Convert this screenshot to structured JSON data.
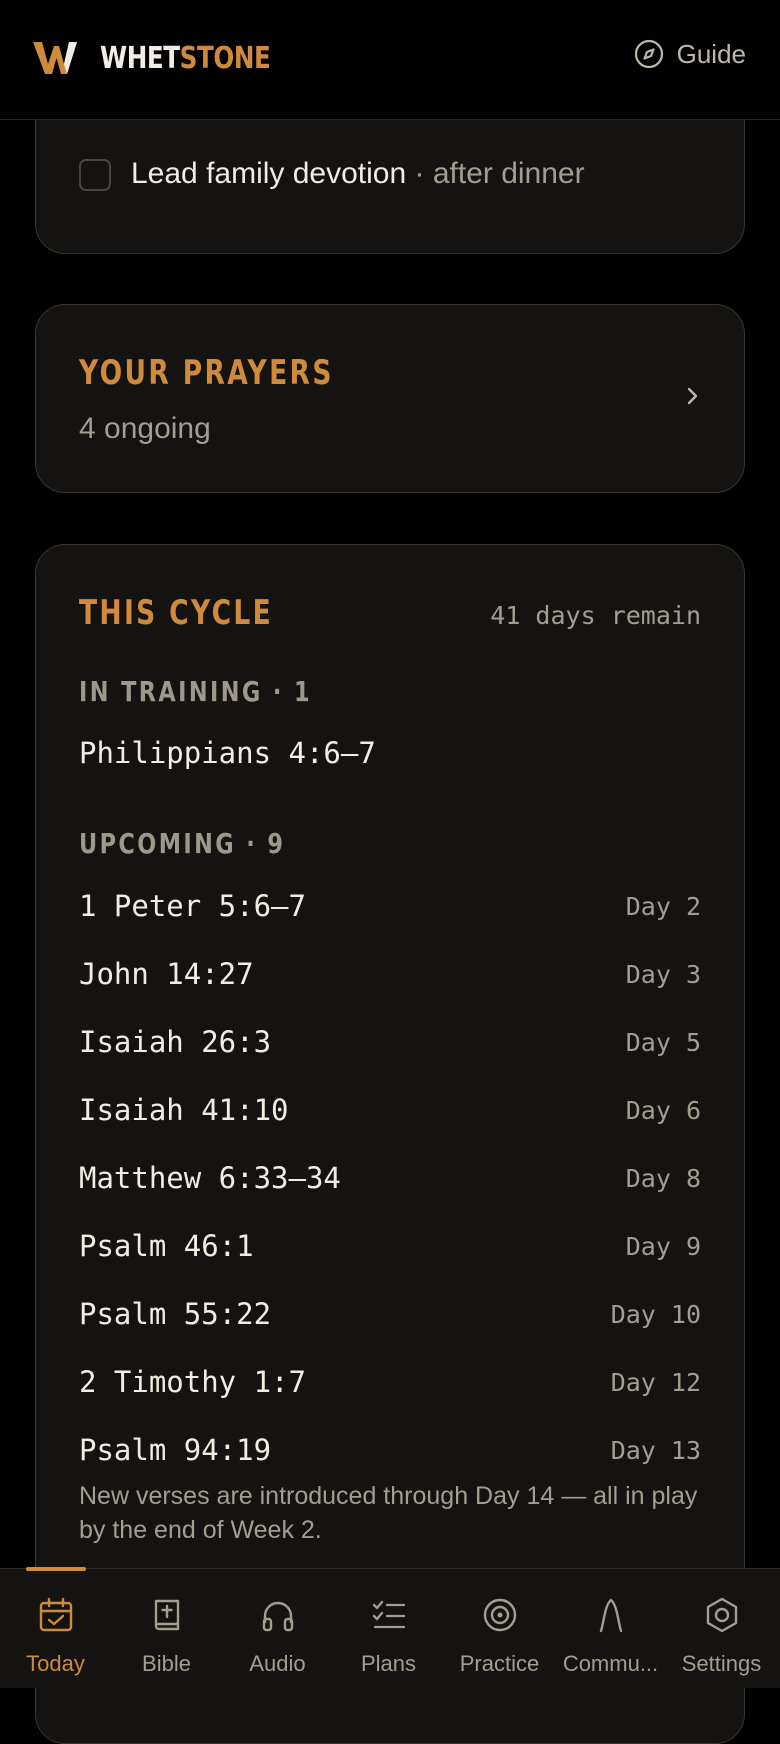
{
  "header": {
    "logo_letter": "W",
    "brand_part1": "WHET",
    "brand_part2": "STONE",
    "guide_label": "Guide"
  },
  "tasks": {
    "visible_item": {
      "label": "Lead family devotion",
      "separator": " · ",
      "when": "after dinner",
      "checked": false
    }
  },
  "prayers": {
    "title": "YOUR PRAYERS",
    "count_text": "4 ongoing"
  },
  "cycle": {
    "title": "THIS CYCLE",
    "remain_text": "41 days remain",
    "in_training_label": "IN TRAINING · 1",
    "in_training": [
      "Philippians 4:6–7"
    ],
    "upcoming_label": "UPCOMING · 9",
    "upcoming": [
      {
        "ref": "1 Peter 5:6–7",
        "day": "Day 2"
      },
      {
        "ref": "John 14:27",
        "day": "Day 3"
      },
      {
        "ref": "Isaiah 26:3",
        "day": "Day 5"
      },
      {
        "ref": "Isaiah 41:10",
        "day": "Day 6"
      },
      {
        "ref": "Matthew 6:33–34",
        "day": "Day 8"
      },
      {
        "ref": "Psalm 46:1",
        "day": "Day 9"
      },
      {
        "ref": "Psalm 55:22",
        "day": "Day 10"
      },
      {
        "ref": "2 Timothy 1:7",
        "day": "Day 12"
      },
      {
        "ref": "Psalm 94:19",
        "day": "Day 13"
      }
    ],
    "footnote": "New verses are introduced through Day 14 — all in play by the end of Week 2."
  },
  "tabs": [
    {
      "label": "Today",
      "icon": "calendar-check-icon",
      "active": true
    },
    {
      "label": "Bible",
      "icon": "bible-icon",
      "active": false
    },
    {
      "label": "Audio",
      "icon": "headphones-icon",
      "active": false
    },
    {
      "label": "Plans",
      "icon": "checklist-icon",
      "active": false
    },
    {
      "label": "Practice",
      "icon": "target-icon",
      "active": false
    },
    {
      "label": "Commu...",
      "icon": "community-icon",
      "active": false
    },
    {
      "label": "Settings",
      "icon": "settings-icon",
      "active": false
    }
  ],
  "colors": {
    "accent": "#d08a3c",
    "background": "#000000",
    "card": "#151311",
    "muted_text": "#a39d92"
  }
}
